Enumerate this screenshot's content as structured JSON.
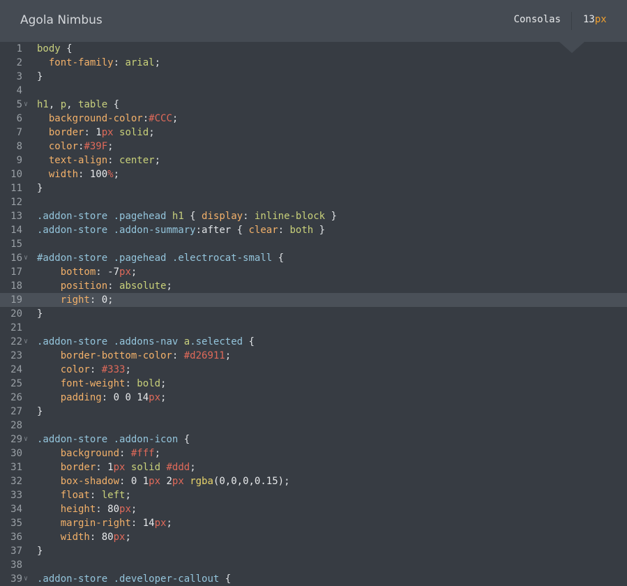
{
  "header": {
    "theme_name": "Agola Nimbus",
    "font_name": "Consolas",
    "font_size_value": "13",
    "font_size_unit": "px"
  },
  "editor": {
    "active_line": 19,
    "lines": [
      {
        "n": "1",
        "fold": false,
        "tokens": [
          [
            "body",
            "tag"
          ],
          [
            " {",
            "punc"
          ]
        ]
      },
      {
        "n": "2",
        "fold": false,
        "tokens": [
          [
            "  ",
            "punc"
          ],
          [
            "font-family",
            "prop"
          ],
          [
            ": ",
            "punc"
          ],
          [
            "arial",
            "val"
          ],
          [
            ";",
            "punc"
          ]
        ]
      },
      {
        "n": "3",
        "fold": false,
        "tokens": [
          [
            "}",
            "punc"
          ]
        ]
      },
      {
        "n": "4",
        "fold": false,
        "tokens": []
      },
      {
        "n": "5",
        "fold": true,
        "tokens": [
          [
            "h1",
            "tag"
          ],
          [
            ", ",
            "punc"
          ],
          [
            "p",
            "tag"
          ],
          [
            ", ",
            "punc"
          ],
          [
            "table",
            "tag"
          ],
          [
            " {",
            "punc"
          ]
        ]
      },
      {
        "n": "6",
        "fold": false,
        "tokens": [
          [
            "  ",
            "punc"
          ],
          [
            "background-color",
            "prop"
          ],
          [
            ":",
            "punc"
          ],
          [
            "#CCC",
            "hex"
          ],
          [
            ";",
            "punc"
          ]
        ]
      },
      {
        "n": "7",
        "fold": false,
        "tokens": [
          [
            "  ",
            "punc"
          ],
          [
            "border",
            "prop"
          ],
          [
            ": ",
            "punc"
          ],
          [
            "1",
            "num"
          ],
          [
            "px",
            "unit"
          ],
          [
            " ",
            "punc"
          ],
          [
            "solid",
            "val"
          ],
          [
            ";",
            "punc"
          ]
        ]
      },
      {
        "n": "8",
        "fold": false,
        "tokens": [
          [
            "  ",
            "punc"
          ],
          [
            "color",
            "prop"
          ],
          [
            ":",
            "punc"
          ],
          [
            "#39F",
            "hex"
          ],
          [
            ";",
            "punc"
          ]
        ]
      },
      {
        "n": "9",
        "fold": false,
        "tokens": [
          [
            "  ",
            "punc"
          ],
          [
            "text-align",
            "prop"
          ],
          [
            ": ",
            "punc"
          ],
          [
            "center",
            "val"
          ],
          [
            ";",
            "punc"
          ]
        ]
      },
      {
        "n": "10",
        "fold": false,
        "tokens": [
          [
            "  ",
            "punc"
          ],
          [
            "width",
            "prop"
          ],
          [
            ": ",
            "punc"
          ],
          [
            "100",
            "num"
          ],
          [
            "%",
            "unit"
          ],
          [
            ";",
            "punc"
          ]
        ]
      },
      {
        "n": "11",
        "fold": false,
        "tokens": [
          [
            "}",
            "punc"
          ]
        ]
      },
      {
        "n": "12",
        "fold": false,
        "tokens": []
      },
      {
        "n": "13",
        "fold": false,
        "tokens": [
          [
            ".addon-store",
            "sel"
          ],
          [
            " ",
            "punc"
          ],
          [
            ".pagehead",
            "sel"
          ],
          [
            " ",
            "punc"
          ],
          [
            "h1",
            "tag"
          ],
          [
            " { ",
            "punc"
          ],
          [
            "display",
            "prop"
          ],
          [
            ": ",
            "punc"
          ],
          [
            "inline-block",
            "val"
          ],
          [
            " }",
            "punc"
          ]
        ]
      },
      {
        "n": "14",
        "fold": false,
        "tokens": [
          [
            ".addon-store",
            "sel"
          ],
          [
            " ",
            "punc"
          ],
          [
            ".addon-summary",
            "sel"
          ],
          [
            ":after",
            "pseudo"
          ],
          [
            " { ",
            "punc"
          ],
          [
            "clear",
            "prop"
          ],
          [
            ": ",
            "punc"
          ],
          [
            "both",
            "val"
          ],
          [
            " }",
            "punc"
          ]
        ]
      },
      {
        "n": "15",
        "fold": false,
        "tokens": []
      },
      {
        "n": "16",
        "fold": true,
        "tokens": [
          [
            "#addon-store",
            "sel"
          ],
          [
            " ",
            "punc"
          ],
          [
            ".pagehead",
            "sel"
          ],
          [
            " ",
            "punc"
          ],
          [
            ".electrocat-small",
            "sel"
          ],
          [
            " {",
            "punc"
          ]
        ]
      },
      {
        "n": "17",
        "fold": false,
        "tokens": [
          [
            "    ",
            "punc"
          ],
          [
            "bottom",
            "prop"
          ],
          [
            ": ",
            "punc"
          ],
          [
            "-7",
            "num"
          ],
          [
            "px",
            "unit"
          ],
          [
            ";",
            "punc"
          ]
        ]
      },
      {
        "n": "18",
        "fold": false,
        "tokens": [
          [
            "    ",
            "punc"
          ],
          [
            "position",
            "prop"
          ],
          [
            ": ",
            "punc"
          ],
          [
            "absolute",
            "val"
          ],
          [
            ";",
            "punc"
          ]
        ]
      },
      {
        "n": "19",
        "fold": false,
        "tokens": [
          [
            "    ",
            "punc"
          ],
          [
            "right",
            "prop"
          ],
          [
            ": ",
            "punc"
          ],
          [
            "0",
            "num"
          ],
          [
            ";",
            "punc"
          ]
        ]
      },
      {
        "n": "20",
        "fold": false,
        "tokens": [
          [
            "}",
            "punc"
          ]
        ]
      },
      {
        "n": "21",
        "fold": false,
        "tokens": []
      },
      {
        "n": "22",
        "fold": true,
        "tokens": [
          [
            ".addon-store",
            "sel"
          ],
          [
            " ",
            "punc"
          ],
          [
            ".addons-nav",
            "sel"
          ],
          [
            " ",
            "punc"
          ],
          [
            "a",
            "tag"
          ],
          [
            ".selected",
            "sel"
          ],
          [
            " {",
            "punc"
          ]
        ]
      },
      {
        "n": "23",
        "fold": false,
        "tokens": [
          [
            "    ",
            "punc"
          ],
          [
            "border-bottom-color",
            "prop"
          ],
          [
            ": ",
            "punc"
          ],
          [
            "#d26911",
            "hex"
          ],
          [
            ";",
            "punc"
          ]
        ]
      },
      {
        "n": "24",
        "fold": false,
        "tokens": [
          [
            "    ",
            "punc"
          ],
          [
            "color",
            "prop"
          ],
          [
            ": ",
            "punc"
          ],
          [
            "#333",
            "hex"
          ],
          [
            ";",
            "punc"
          ]
        ]
      },
      {
        "n": "25",
        "fold": false,
        "tokens": [
          [
            "    ",
            "punc"
          ],
          [
            "font-weight",
            "prop"
          ],
          [
            ": ",
            "punc"
          ],
          [
            "bold",
            "val"
          ],
          [
            ";",
            "punc"
          ]
        ]
      },
      {
        "n": "26",
        "fold": false,
        "tokens": [
          [
            "    ",
            "punc"
          ],
          [
            "padding",
            "prop"
          ],
          [
            ": ",
            "punc"
          ],
          [
            "0 0 14",
            "num"
          ],
          [
            "px",
            "unit"
          ],
          [
            ";",
            "punc"
          ]
        ]
      },
      {
        "n": "27",
        "fold": false,
        "tokens": [
          [
            "}",
            "punc"
          ]
        ]
      },
      {
        "n": "28",
        "fold": false,
        "tokens": []
      },
      {
        "n": "29",
        "fold": true,
        "tokens": [
          [
            ".addon-store",
            "sel"
          ],
          [
            " ",
            "punc"
          ],
          [
            ".addon-icon",
            "sel"
          ],
          [
            " {",
            "punc"
          ]
        ]
      },
      {
        "n": "30",
        "fold": false,
        "tokens": [
          [
            "    ",
            "punc"
          ],
          [
            "background",
            "prop"
          ],
          [
            ": ",
            "punc"
          ],
          [
            "#fff",
            "hex"
          ],
          [
            ";",
            "punc"
          ]
        ]
      },
      {
        "n": "31",
        "fold": false,
        "tokens": [
          [
            "    ",
            "punc"
          ],
          [
            "border",
            "prop"
          ],
          [
            ": ",
            "punc"
          ],
          [
            "1",
            "num"
          ],
          [
            "px",
            "unit"
          ],
          [
            " ",
            "punc"
          ],
          [
            "solid",
            "val"
          ],
          [
            " ",
            "punc"
          ],
          [
            "#ddd",
            "hex"
          ],
          [
            ";",
            "punc"
          ]
        ]
      },
      {
        "n": "32",
        "fold": false,
        "tokens": [
          [
            "    ",
            "punc"
          ],
          [
            "box-shadow",
            "prop"
          ],
          [
            ": ",
            "punc"
          ],
          [
            "0 1",
            "num"
          ],
          [
            "px",
            "unit"
          ],
          [
            " ",
            "punc"
          ],
          [
            "2",
            "num"
          ],
          [
            "px",
            "unit"
          ],
          [
            " ",
            "punc"
          ],
          [
            "rgba",
            "fn"
          ],
          [
            "(0,0,0,0.15)",
            "num"
          ],
          [
            ";",
            "punc"
          ]
        ]
      },
      {
        "n": "33",
        "fold": false,
        "tokens": [
          [
            "    ",
            "punc"
          ],
          [
            "float",
            "prop"
          ],
          [
            ": ",
            "punc"
          ],
          [
            "left",
            "val"
          ],
          [
            ";",
            "punc"
          ]
        ]
      },
      {
        "n": "34",
        "fold": false,
        "tokens": [
          [
            "    ",
            "punc"
          ],
          [
            "height",
            "prop"
          ],
          [
            ": ",
            "punc"
          ],
          [
            "80",
            "num"
          ],
          [
            "px",
            "unit"
          ],
          [
            ";",
            "punc"
          ]
        ]
      },
      {
        "n": "35",
        "fold": false,
        "tokens": [
          [
            "    ",
            "punc"
          ],
          [
            "margin-right",
            "prop"
          ],
          [
            ": ",
            "punc"
          ],
          [
            "14",
            "num"
          ],
          [
            "px",
            "unit"
          ],
          [
            ";",
            "punc"
          ]
        ]
      },
      {
        "n": "36",
        "fold": false,
        "tokens": [
          [
            "    ",
            "punc"
          ],
          [
            "width",
            "prop"
          ],
          [
            ": ",
            "punc"
          ],
          [
            "80",
            "num"
          ],
          [
            "px",
            "unit"
          ],
          [
            ";",
            "punc"
          ]
        ]
      },
      {
        "n": "37",
        "fold": false,
        "tokens": [
          [
            "}",
            "punc"
          ]
        ]
      },
      {
        "n": "38",
        "fold": false,
        "tokens": []
      },
      {
        "n": "39",
        "fold": true,
        "tokens": [
          [
            ".addon-store",
            "sel"
          ],
          [
            " ",
            "punc"
          ],
          [
            ".developer-callout",
            "sel"
          ],
          [
            " {",
            "punc"
          ]
        ]
      }
    ]
  }
}
